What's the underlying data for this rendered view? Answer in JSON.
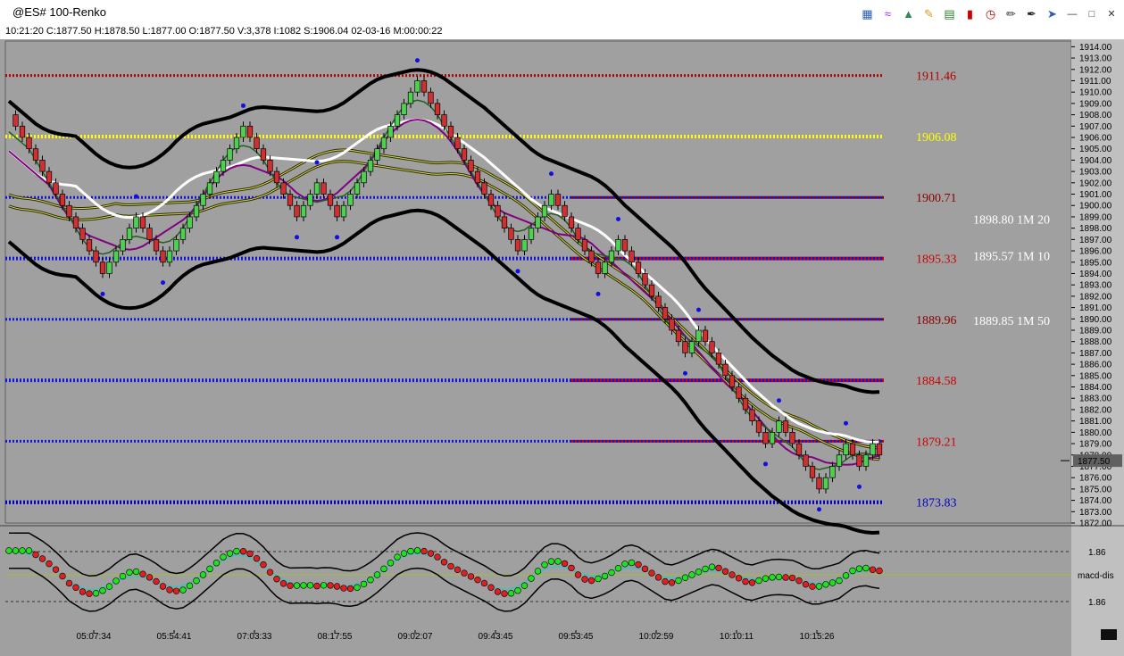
{
  "window": {
    "title": "@ES# 100-Renko",
    "info_line": "10:21:20  C:1877.50  H:1878.50  L:1877.00  O:1877.50  V:3,378  I:1082  S:1906.04  02-03-16  M:00:00:22",
    "toolbar_icons": [
      "cubes-icon",
      "waves-icon",
      "tree-icon",
      "pencil-icon",
      "bar-chart-icon",
      "candle-icon",
      "clock-icon",
      "edit-icon",
      "pen-icon",
      "pin-icon"
    ],
    "window_buttons": {
      "minimize": "▭",
      "restore": "▣",
      "close": "✕"
    }
  },
  "chart_data": {
    "type": "line",
    "ylim": [
      1872,
      1914.5
    ],
    "y_ticks": [
      "1914.00",
      "1913.00",
      "1912.00",
      "1911.00",
      "1910.00",
      "1909.00",
      "1908.00",
      "1907.00",
      "1906.00",
      "1905.00",
      "1904.00",
      "1903.00",
      "1902.00",
      "1901.00",
      "1900.00",
      "1899.00",
      "1898.00",
      "1897.00",
      "1896.00",
      "1895.00",
      "1894.00",
      "1893.00",
      "1892.00",
      "1891.00",
      "1890.00",
      "1889.00",
      "1888.00",
      "1887.00",
      "1886.00",
      "1885.00",
      "1884.00",
      "1883.00",
      "1882.00",
      "1881.00",
      "1880.00",
      "1879.00",
      "1878.00",
      "1877.00",
      "1876.00",
      "1875.00",
      "1874.00",
      "1873.00",
      "1872.00"
    ],
    "current_price": "1877.50",
    "x_ticks": [
      "05:07:34",
      "05:54:41",
      "07:03:33",
      "08:17:55",
      "09:02:07",
      "09:43:45",
      "09:53:45",
      "10:02:59",
      "10:10:11",
      "10:15:26"
    ],
    "levels": [
      {
        "value": 1911.46,
        "label": "1911.46",
        "color": "#b00000",
        "style": "dotted"
      },
      {
        "value": 1906.08,
        "label": "1906.08",
        "color": "#ffff00",
        "style": "thick"
      },
      {
        "value": 1900.71,
        "label": "1900.71",
        "color": "#8b0000",
        "style": "dotted"
      },
      {
        "value": 1895.33,
        "label": "1895.33",
        "color": "#cc0000",
        "style": "thick"
      },
      {
        "value": 1889.96,
        "label": "1889.96",
        "color": "#8b0000",
        "style": "dotted"
      },
      {
        "value": 1884.58,
        "label": "1884.58",
        "color": "#cc0000",
        "style": "thick"
      },
      {
        "value": 1879.21,
        "label": "1879.21",
        "color": "#cc0000",
        "style": "dotted"
      },
      {
        "value": 1873.83,
        "label": "1873.83",
        "color": "#0000cc",
        "style": "thick"
      }
    ],
    "blue_level_lines": [
      1900.71,
      1895.33,
      1889.96,
      1884.58,
      1879.21,
      1873.83
    ],
    "annotations": [
      {
        "value": 1898.8,
        "label": "1898.80  1M 20"
      },
      {
        "value": 1895.57,
        "label": "1895.57  1M 10"
      },
      {
        "value": 1889.85,
        "label": "1889.85  1M 50"
      }
    ],
    "renko_closes": [
      1908,
      1907,
      1906,
      1905,
      1904,
      1903,
      1902,
      1901,
      1900,
      1899,
      1898,
      1897,
      1896,
      1895,
      1894,
      1895,
      1896,
      1897,
      1898,
      1899,
      1898,
      1897,
      1896,
      1895,
      1896,
      1897,
      1898,
      1899,
      1900,
      1901,
      1902,
      1903,
      1904,
      1905,
      1906,
      1907,
      1906,
      1905,
      1904,
      1903,
      1902,
      1901,
      1900,
      1899,
      1900,
      1901,
      1902,
      1901,
      1900,
      1899,
      1900,
      1901,
      1902,
      1903,
      1904,
      1905,
      1906,
      1907,
      1908,
      1909,
      1910,
      1911,
      1910,
      1909,
      1908,
      1907,
      1906,
      1905,
      1904,
      1903,
      1902,
      1901,
      1900,
      1899,
      1898,
      1897,
      1896,
      1897,
      1898,
      1899,
      1900,
      1901,
      1900,
      1899,
      1898,
      1897,
      1896,
      1895,
      1894,
      1895,
      1896,
      1897,
      1896,
      1895,
      1894,
      1893,
      1892,
      1891,
      1890,
      1889,
      1888,
      1887,
      1888,
      1889,
      1888,
      1887,
      1886,
      1885,
      1884,
      1883,
      1882,
      1881,
      1880,
      1879,
      1880,
      1881,
      1880,
      1879,
      1878,
      1877,
      1876,
      1875,
      1876,
      1877,
      1878,
      1879,
      1878,
      1877,
      1878,
      1879,
      1878
    ],
    "indicator": {
      "name": "macd-dis",
      "upper_label": "1.86",
      "lower_label": "1.86"
    }
  }
}
